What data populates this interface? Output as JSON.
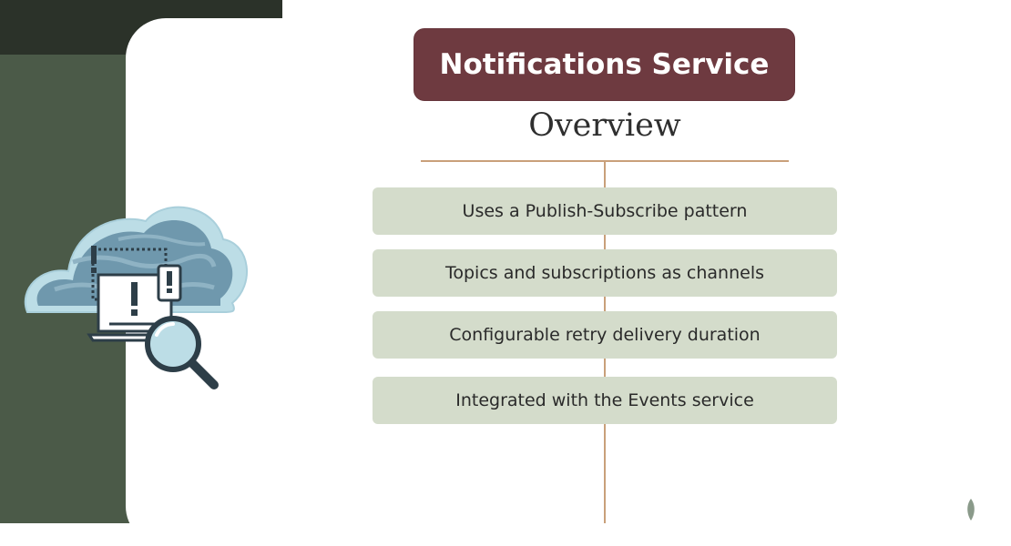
{
  "slide": {
    "title": "Notifications Service",
    "subtitle": "Overview",
    "items": [
      "Uses a Publish-Subscribe pattern",
      "Topics and subscriptions as channels",
      "Configurable retry delivery duration",
      "Integrated with the Events service"
    ]
  },
  "illustration": {
    "name": "cloud-devices-magnifier-icon"
  },
  "colors": {
    "title_bg": "#6e3a40",
    "item_bg": "#d4dccb",
    "connector": "#c9a07a",
    "sidebar_dark": "#2b3229",
    "sidebar_green": "#4b5a48"
  }
}
